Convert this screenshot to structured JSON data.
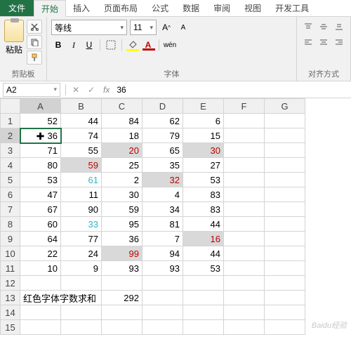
{
  "tabs": {
    "file": "文件",
    "home": "开始",
    "insert": "插入",
    "layout": "页面布局",
    "formulas": "公式",
    "data": "数据",
    "review": "审阅",
    "view": "视图",
    "dev": "开发工具"
  },
  "ribbon": {
    "clipboard_label": "剪贴板",
    "paste_label": "粘贴",
    "font_label": "字体",
    "align_label": "对齐方式",
    "font_name": "等线",
    "font_size": "11",
    "wen": "wén"
  },
  "namebox": {
    "ref": "A2",
    "value": "36"
  },
  "columns": [
    "A",
    "B",
    "C",
    "D",
    "E",
    "F",
    "G"
  ],
  "rows": [
    "1",
    "2",
    "3",
    "4",
    "5",
    "6",
    "7",
    "8",
    "9",
    "10",
    "11",
    "12",
    "13",
    "14",
    "15"
  ],
  "grid": [
    [
      {
        "v": "52"
      },
      {
        "v": "44"
      },
      {
        "v": "84"
      },
      {
        "v": "62"
      },
      {
        "v": "6"
      },
      {
        "v": ""
      },
      {
        "v": ""
      }
    ],
    [
      {
        "v": "36"
      },
      {
        "v": "74"
      },
      {
        "v": "18"
      },
      {
        "v": "79"
      },
      {
        "v": "15"
      },
      {
        "v": ""
      },
      {
        "v": ""
      }
    ],
    [
      {
        "v": "71"
      },
      {
        "v": "55"
      },
      {
        "v": "20",
        "c": "red",
        "h": true
      },
      {
        "v": "65"
      },
      {
        "v": "30",
        "c": "red",
        "h": true
      },
      {
        "v": ""
      },
      {
        "v": ""
      }
    ],
    [
      {
        "v": "80"
      },
      {
        "v": "59",
        "c": "red",
        "h": true
      },
      {
        "v": "25"
      },
      {
        "v": "35"
      },
      {
        "v": "27"
      },
      {
        "v": ""
      },
      {
        "v": ""
      }
    ],
    [
      {
        "v": "53"
      },
      {
        "v": "61",
        "c": "cyan"
      },
      {
        "v": "2"
      },
      {
        "v": "32",
        "c": "red",
        "h": true
      },
      {
        "v": "53"
      },
      {
        "v": ""
      },
      {
        "v": ""
      }
    ],
    [
      {
        "v": "47"
      },
      {
        "v": "11"
      },
      {
        "v": "30"
      },
      {
        "v": "4"
      },
      {
        "v": "83"
      },
      {
        "v": ""
      },
      {
        "v": ""
      }
    ],
    [
      {
        "v": "67"
      },
      {
        "v": "90"
      },
      {
        "v": "59"
      },
      {
        "v": "34"
      },
      {
        "v": "83"
      },
      {
        "v": ""
      },
      {
        "v": ""
      }
    ],
    [
      {
        "v": "60"
      },
      {
        "v": "33",
        "c": "cyan"
      },
      {
        "v": "95"
      },
      {
        "v": "81"
      },
      {
        "v": "44"
      },
      {
        "v": ""
      },
      {
        "v": ""
      }
    ],
    [
      {
        "v": "64"
      },
      {
        "v": "77"
      },
      {
        "v": "36"
      },
      {
        "v": "7"
      },
      {
        "v": "16",
        "c": "red",
        "h": true
      },
      {
        "v": ""
      },
      {
        "v": ""
      }
    ],
    [
      {
        "v": "22"
      },
      {
        "v": "24"
      },
      {
        "v": "99",
        "c": "red",
        "h": true
      },
      {
        "v": "94"
      },
      {
        "v": "44"
      },
      {
        "v": ""
      },
      {
        "v": ""
      }
    ],
    [
      {
        "v": "10"
      },
      {
        "v": "9"
      },
      {
        "v": "93"
      },
      {
        "v": "93"
      },
      {
        "v": "53"
      },
      {
        "v": ""
      },
      {
        "v": ""
      }
    ],
    [
      {
        "v": ""
      },
      {
        "v": ""
      },
      {
        "v": ""
      },
      {
        "v": ""
      },
      {
        "v": ""
      },
      {
        "v": ""
      },
      {
        "v": ""
      }
    ],
    [
      {
        "v": "红色字体字数求和",
        "t": true,
        "span": 2
      },
      {
        "v": ""
      },
      {
        "v": "292"
      },
      {
        "v": ""
      },
      {
        "v": ""
      },
      {
        "v": ""
      },
      {
        "v": ""
      }
    ],
    [
      {
        "v": ""
      },
      {
        "v": ""
      },
      {
        "v": ""
      },
      {
        "v": ""
      },
      {
        "v": ""
      },
      {
        "v": ""
      },
      {
        "v": ""
      }
    ],
    [
      {
        "v": ""
      },
      {
        "v": ""
      },
      {
        "v": ""
      },
      {
        "v": ""
      },
      {
        "v": ""
      },
      {
        "v": ""
      },
      {
        "v": ""
      }
    ]
  ],
  "active": {
    "r": 1,
    "c": 0
  },
  "watermark": "Baidu经验"
}
